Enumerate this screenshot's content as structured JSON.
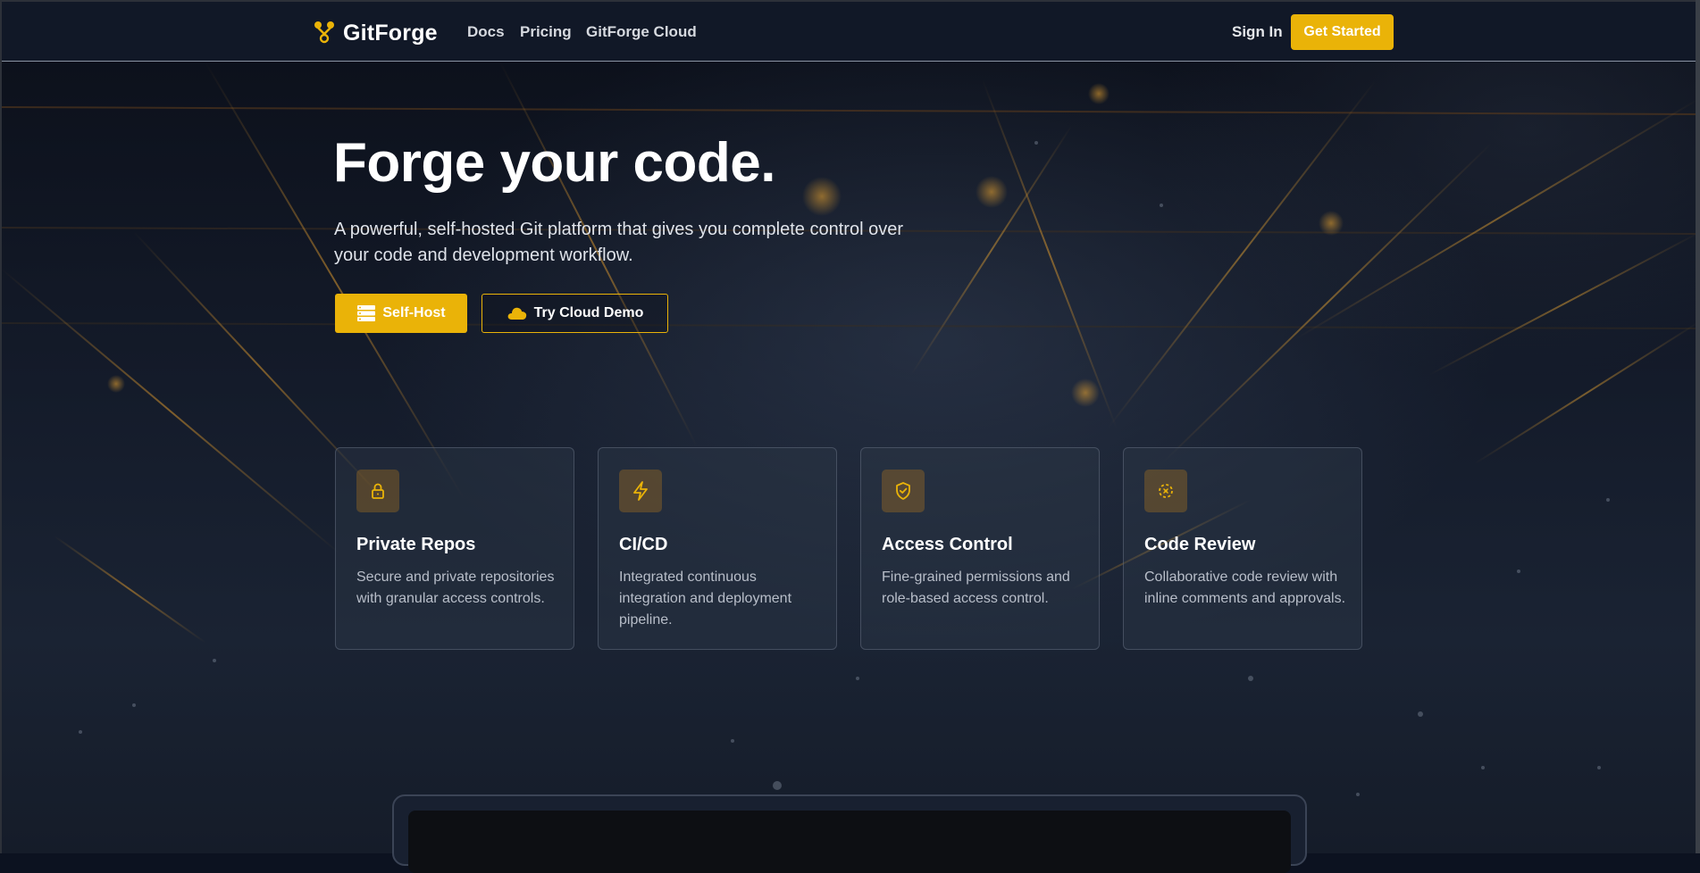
{
  "nav": {
    "brand": "GitForge",
    "links": [
      "Docs",
      "Pricing",
      "GitForge Cloud"
    ],
    "sign_in": "Sign In",
    "get_started": "Get Started"
  },
  "hero": {
    "title": "Forge your code.",
    "subtitle": "A powerful, self-hosted Git platform that gives you complete control over your code and development workflow.",
    "primary_button": "Self-Host",
    "secondary_button": "Try Cloud Demo"
  },
  "features": [
    {
      "icon": "lock-icon",
      "title": "Private Repos",
      "description": "Secure and private repositories with granular access controls."
    },
    {
      "icon": "lightning-icon",
      "title": "CI/CD",
      "description": "Integrated continuous integration and deployment pipeline."
    },
    {
      "icon": "shield-check-icon",
      "title": "Access Control",
      "description": "Fine-grained permissions and role-based access control."
    },
    {
      "icon": "code-review-icon",
      "title": "Code Review",
      "description": "Collaborative code review with inline comments and approvals."
    }
  ],
  "colors": {
    "accent": "#eab308",
    "nav_bg": "#111827",
    "page_bg": "#0c1220",
    "card_bg": "#2d3748"
  }
}
